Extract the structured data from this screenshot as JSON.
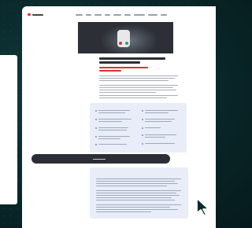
{
  "colors": {
    "background": "#0a2a2c",
    "page": "#ffffff",
    "accent_red": "#d8342b",
    "card": "#e9edf8",
    "toast": "#2b2f35",
    "accept_green": "#2fa84f"
  },
  "icons": {
    "logo": "brand-logo-icon",
    "cursor": "click-pointer-icon",
    "hang_up": "phone-hangup-icon",
    "accept": "phone-accept-icon"
  }
}
